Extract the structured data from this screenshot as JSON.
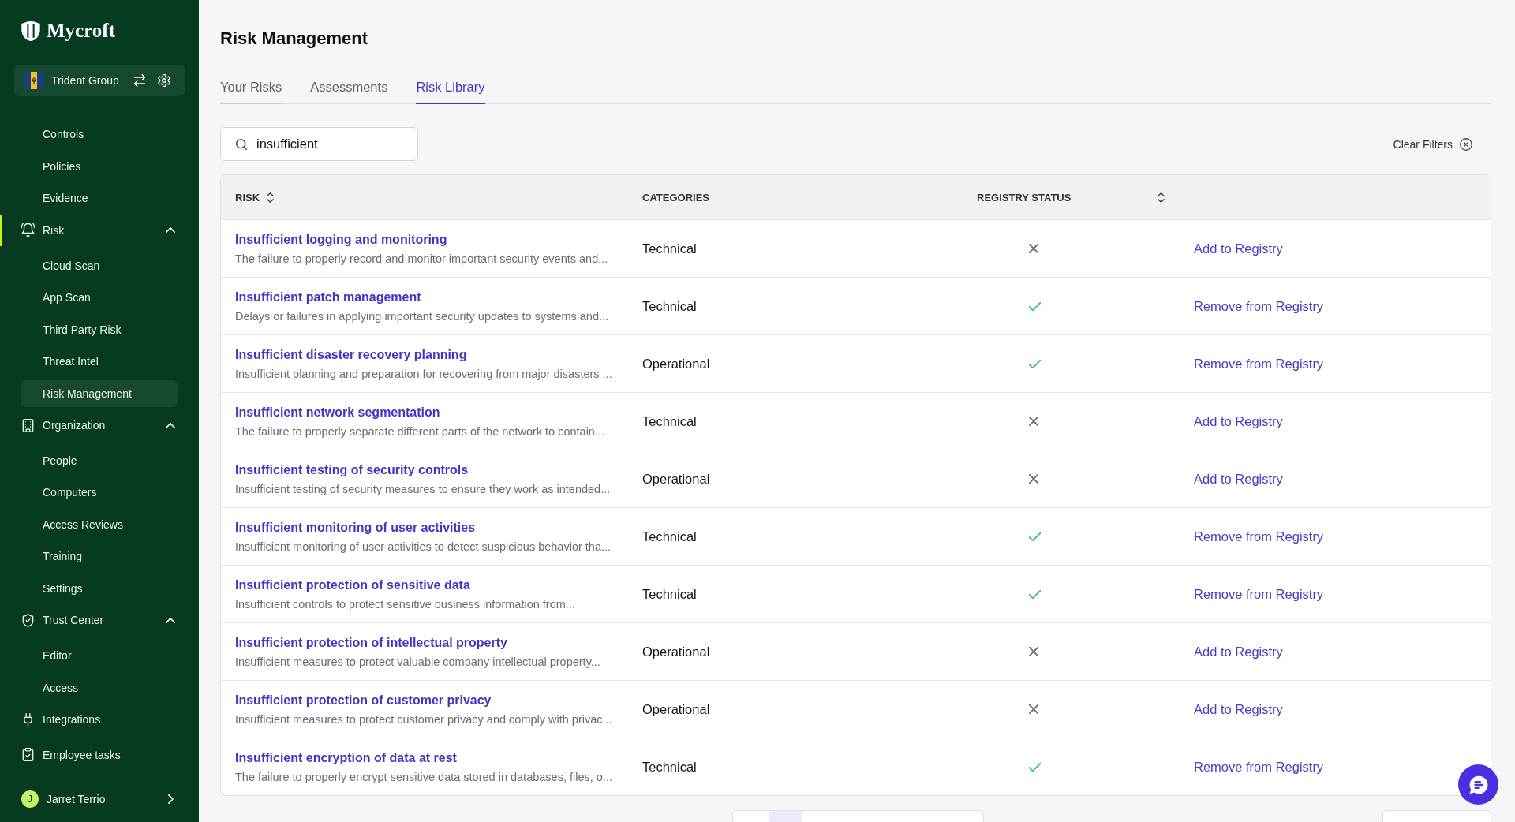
{
  "sidebar": {
    "brand": "Mycroft",
    "org": {
      "name": "Trident Group"
    },
    "nav": [
      {
        "kind": "item",
        "label": "Controls",
        "selected": false
      },
      {
        "kind": "item",
        "label": "Policies",
        "selected": false
      },
      {
        "kind": "item",
        "label": "Evidence",
        "selected": false
      },
      {
        "kind": "section",
        "label": "Risk",
        "selected": true,
        "expanded": true,
        "children": [
          {
            "label": "Cloud Scan",
            "selected": false
          },
          {
            "label": "App Scan",
            "selected": false
          },
          {
            "label": "Third Party Risk",
            "selected": false
          },
          {
            "label": "Threat Intel",
            "selected": false
          },
          {
            "label": "Risk Management",
            "selected": true
          }
        ]
      },
      {
        "kind": "section",
        "label": "Organization",
        "selected": false,
        "expanded": true,
        "children": [
          {
            "label": "People",
            "selected": false
          },
          {
            "label": "Computers",
            "selected": false
          },
          {
            "label": "Access Reviews",
            "selected": false
          },
          {
            "label": "Training",
            "selected": false
          },
          {
            "label": "Settings",
            "selected": false
          }
        ]
      },
      {
        "kind": "section",
        "label": "Trust Center",
        "selected": false,
        "expanded": true,
        "children": [
          {
            "label": "Editor",
            "selected": false
          },
          {
            "label": "Access",
            "selected": false
          }
        ]
      },
      {
        "kind": "section",
        "label": "Integrations",
        "selected": false
      },
      {
        "kind": "section",
        "label": "Employee tasks",
        "selected": false
      }
    ],
    "user": {
      "initial": "J",
      "name": "Jarret Terrio"
    }
  },
  "page": {
    "title": "Risk Management"
  },
  "tabs": [
    {
      "label": "Your Risks",
      "selected": false,
      "hovered": true
    },
    {
      "label": "Assessments",
      "selected": false,
      "hovered": false
    },
    {
      "label": "Risk Library",
      "selected": true,
      "hovered": false
    }
  ],
  "search": {
    "value": "insufficient"
  },
  "clear_filters": "Clear Filters",
  "table": {
    "columns": [
      {
        "label": "RISK",
        "sortable": true
      },
      {
        "label": "CATEGORIES",
        "sortable": false
      },
      {
        "label": "REGISTRY STATUS",
        "sortable": true
      }
    ],
    "rows": [
      {
        "title": "Insufficient logging and monitoring",
        "description": "The failure to properly record and monitor important security events and...",
        "category": "Technical",
        "in_registry": false,
        "action": "Add to Registry"
      },
      {
        "title": "Insufficient patch management",
        "description": "Delays or failures in applying important security updates to systems and...",
        "category": "Technical",
        "in_registry": true,
        "action": "Remove from Registry"
      },
      {
        "title": "Insufficient disaster recovery planning",
        "description": "Insufficient planning and preparation for recovering from major disasters ...",
        "category": "Operational",
        "in_registry": true,
        "action": "Remove from Registry"
      },
      {
        "title": "Insufficient network segmentation",
        "description": "The failure to properly separate different parts of the network to contain...",
        "category": "Technical",
        "in_registry": false,
        "action": "Add to Registry"
      },
      {
        "title": "Insufficient testing of security controls",
        "description": "Insufficient testing of security measures to ensure they work as intended...",
        "category": "Operational",
        "in_registry": false,
        "action": "Add to Registry"
      },
      {
        "title": "Insufficient monitoring of user activities",
        "description": "Insufficient monitoring of user activities to detect suspicious behavior tha...",
        "category": "Technical",
        "in_registry": true,
        "action": "Remove from Registry"
      },
      {
        "title": "Insufficient protection of sensitive data",
        "description": "Insufficient controls to protect sensitive business information from...",
        "category": "Technical",
        "in_registry": true,
        "action": "Remove from Registry"
      },
      {
        "title": "Insufficient protection of intellectual property",
        "description": "Insufficient measures to protect valuable company intellectual property...",
        "category": "Operational",
        "in_registry": false,
        "action": "Add to Registry"
      },
      {
        "title": "Insufficient protection of customer privacy",
        "description": "Insufficient measures to protect customer privacy and comply with privac...",
        "category": "Operational",
        "in_registry": false,
        "action": "Add to Registry"
      },
      {
        "title": "Insufficient encryption of data at rest",
        "description": "The failure to properly encrypt sensitive data stored in databases, files, o...",
        "category": "Technical",
        "in_registry": true,
        "action": "Remove from Registry"
      }
    ]
  }
}
